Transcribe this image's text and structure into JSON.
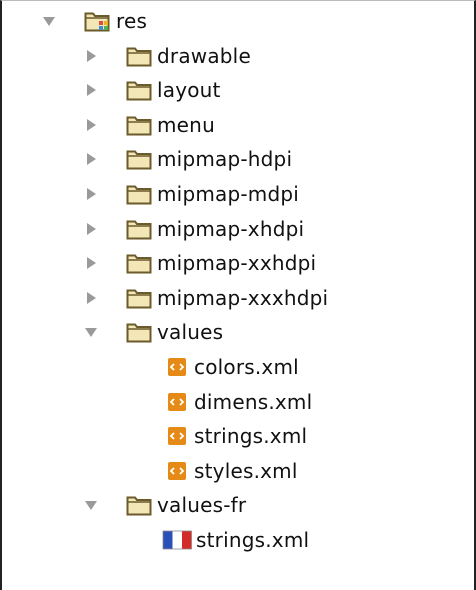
{
  "tree": {
    "root": {
      "label": "res",
      "expanded": true,
      "icon": "resource-folder-icon"
    },
    "folders": [
      {
        "label": "drawable",
        "expanded": false
      },
      {
        "label": "layout",
        "expanded": false
      },
      {
        "label": "menu",
        "expanded": false
      },
      {
        "label": "mipmap-hdpi",
        "expanded": false
      },
      {
        "label": "mipmap-mdpi",
        "expanded": false
      },
      {
        "label": "mipmap-xhdpi",
        "expanded": false
      },
      {
        "label": "mipmap-xxhdpi",
        "expanded": false
      },
      {
        "label": "mipmap-xxxhdpi",
        "expanded": false
      },
      {
        "label": "values",
        "expanded": true,
        "files": [
          {
            "label": "colors.xml",
            "icon": "xml-file-icon"
          },
          {
            "label": "dimens.xml",
            "icon": "xml-file-icon"
          },
          {
            "label": "strings.xml",
            "icon": "xml-file-icon"
          },
          {
            "label": "styles.xml",
            "icon": "xml-file-icon"
          }
        ]
      },
      {
        "label": "values-fr",
        "expanded": true,
        "files": [
          {
            "label": "strings.xml",
            "icon": "french-flag-icon"
          }
        ]
      }
    ]
  },
  "colors": {
    "folder_stroke": "#6b5a2a",
    "folder_fill": "#f3e7b8",
    "twisty": "#9a9a9a",
    "xml_orange": "#e58a16",
    "flag_blue": "#2a50b8",
    "flag_red": "#d42a2a"
  }
}
